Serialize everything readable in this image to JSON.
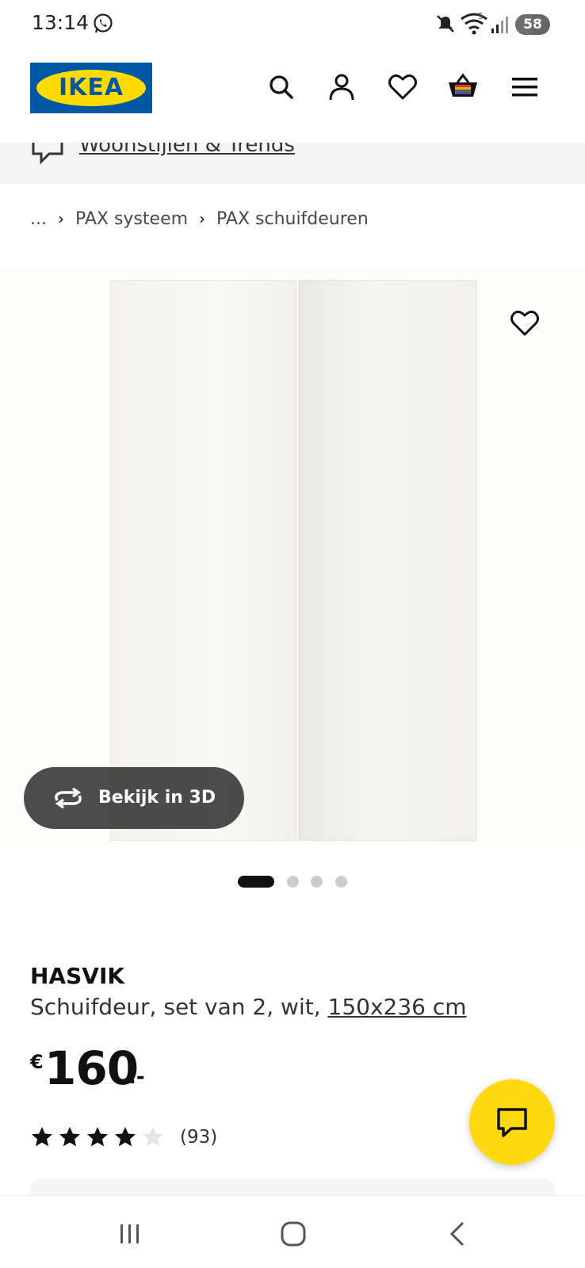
{
  "status_bar": {
    "time": "13:14",
    "battery_level": "58",
    "wifi_label": "5",
    "icons": [
      "whatsapp-icon",
      "mute-icon",
      "wifi-icon",
      "signal-icon",
      "battery-icon"
    ]
  },
  "header": {
    "logo_text": "IKEA",
    "icons": [
      "search-icon",
      "account-icon",
      "heart-icon",
      "basket-icon",
      "menu-icon"
    ]
  },
  "subnav": {
    "link_label": "Woonstijlen & Trends",
    "icon": "chat-bubble-icon"
  },
  "breadcrumb": {
    "items": [
      "...",
      "PAX systeem",
      "PAX schuifdeuren"
    ]
  },
  "product": {
    "view_3d_label": "Bekijk in 3D",
    "carousel": {
      "total": 4,
      "active": 1
    },
    "name": "HASVIK",
    "description": "Schuifdeur, set van 2, wit, ",
    "size": "150x236 cm",
    "price": {
      "currency": "€",
      "amount": "160",
      "suffix": ".-"
    },
    "rating": {
      "stars": 4,
      "max": 5,
      "count_label": "(93)"
    }
  },
  "colors": {
    "ikea_blue": "#0058a3",
    "ikea_yellow": "#ffdb00",
    "chat_yellow": "#ffd90f",
    "text_dark": "#111111"
  },
  "navbar": {
    "icons": [
      "recent-apps-icon",
      "home-icon",
      "back-icon"
    ]
  }
}
